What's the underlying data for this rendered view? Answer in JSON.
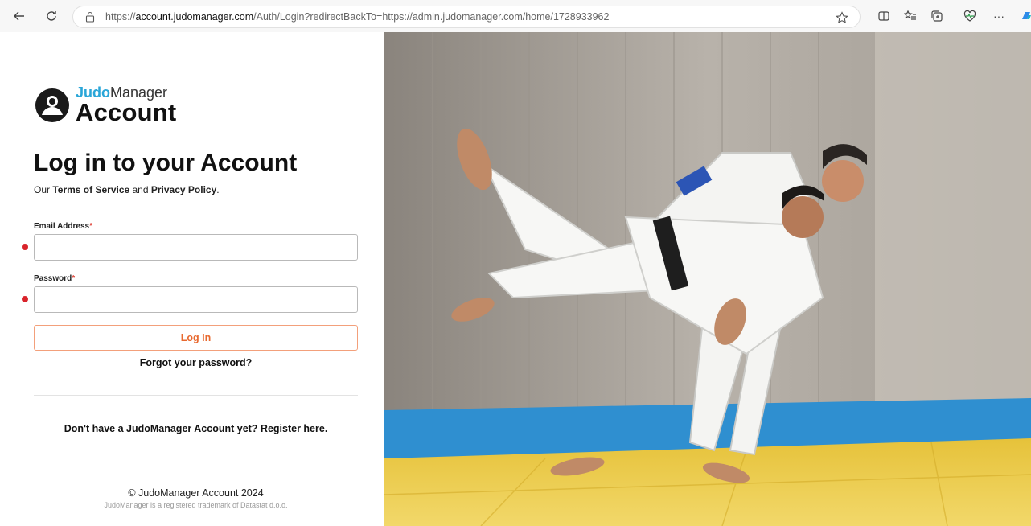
{
  "browser": {
    "url_prefix": "https://",
    "url_host": "account.judomanager.com",
    "url_rest": "/Auth/Login?redirectBackTo=https://admin.judomanager.com/home/1728933962",
    "more_label": "···"
  },
  "logo": {
    "brand": "Judo",
    "product": "Manager",
    "subtitle": "Account"
  },
  "login": {
    "title": "Log in to your Account",
    "subtitle_prefix": "Our ",
    "terms_link": "Terms of Service",
    "subtitle_and": " and ",
    "privacy_link": "Privacy Policy",
    "subtitle_suffix": ".",
    "email_label": "Email Address",
    "password_label": "Password",
    "required_mark": "*",
    "email_value": "",
    "password_value": "",
    "login_button": "Log In",
    "forgot_link": "Forgot your password?",
    "register_prefix": "Don't have a JudoManager Account yet? ",
    "register_link": "Register here."
  },
  "footer": {
    "copyright": "© JudoManager Account 2024",
    "trademark": "JudoManager is a registered trademark of Datastat d.o.o."
  },
  "colors": {
    "accent": "#e8692f",
    "brand_blue": "#2aa6d8",
    "required_dot": "#d9232b"
  },
  "icons": {
    "back": "back-arrow-icon",
    "refresh": "refresh-icon",
    "lock": "lock-icon",
    "star": "favorite-star-icon",
    "split": "split-screen-icon",
    "favorites": "favorites-list-icon",
    "collections": "collections-icon",
    "performance": "heart-pulse-icon",
    "more": "more-icon",
    "copilot": "copilot-icon"
  }
}
